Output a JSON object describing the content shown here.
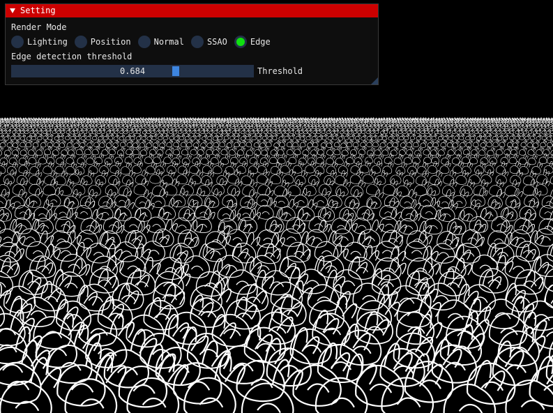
{
  "window": {
    "title": "Setting",
    "collapse_icon": "triangle-down-icon",
    "title_color": "#cc0000"
  },
  "render_mode": {
    "label": "Render Mode",
    "options": [
      "Lighting",
      "Position",
      "Normal",
      "SSAO",
      "Edge"
    ],
    "selected": "Edge",
    "active_color": "#10e010"
  },
  "edge": {
    "label": "Edge detection threshold",
    "slider_value": "0.684",
    "slider_fraction": 0.684,
    "slider_label": "Threshold",
    "grab_color": "#3d85e0"
  },
  "scene": {
    "description_icon": "edge-detected-bunny-field",
    "line_color": "#ffffff",
    "background": "#000000"
  }
}
